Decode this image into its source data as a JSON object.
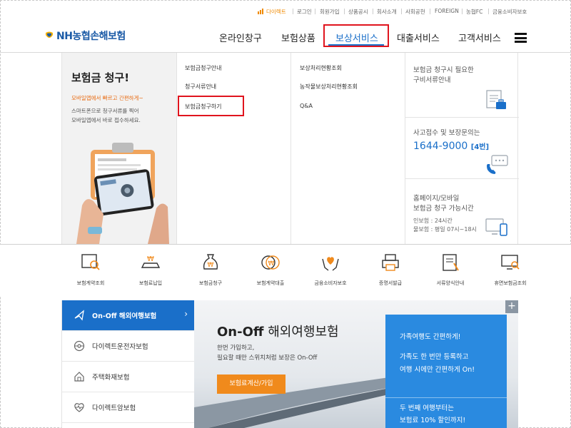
{
  "util_bar": {
    "items": [
      "다이렉트",
      "로그인",
      "회원가입",
      "상품공시",
      "회사소개",
      "사회공헌",
      "FOREIGN",
      "농협FC",
      "금융소비자보호"
    ]
  },
  "header": {
    "logo_text": "NH농협손해보험",
    "nav": [
      "온라인창구",
      "보험상품",
      "보상서비스",
      "대출서비스",
      "고객서비스"
    ],
    "active_nav": "보상서비스"
  },
  "mega_menu": {
    "promo": {
      "title": "보험금 청구!",
      "subtitle": "모바일앱에서 빠르고 간편하게~",
      "desc_line1": "스마트폰으로 청구서류를 찍어",
      "desc_line2": "모바일앱에서 바로 접수하세요."
    },
    "col1": [
      "보험금청구안내",
      "청구서류안내",
      "보험금청구하기"
    ],
    "col2": [
      "보상처리현황조회",
      "농작물보상처리현황조회",
      "Q&A"
    ],
    "info": {
      "docs_line1": "보험금 청구시 필요한",
      "docs_line2": "구비서류안내",
      "call_line1": "사고접수 및 보장문의는",
      "phone": "1644-9000",
      "phone_ext": "[4번]",
      "hours_line1": "홈페이지/모바일",
      "hours_line2": "보험금 청구 가능시간",
      "hours_line3": "인보험 : 24시간",
      "hours_line4": "물보험 : 평일 07시~18시"
    }
  },
  "quick_menu": [
    "보험계약조회",
    "보험료납입",
    "보험금청구",
    "보험계약대출",
    "금융소비자보호",
    "증명서발급",
    "서류양식안내",
    "휴면보험금조회"
  ],
  "products": [
    {
      "label": "On-Off 해외여행보험",
      "icon": "plane-icon"
    },
    {
      "label": "다이렉트운전자보험",
      "icon": "steering-wheel-icon"
    },
    {
      "label": "주택화재보험",
      "icon": "house-icon"
    },
    {
      "label": "다이렉트암보험",
      "icon": "heartbeat-icon"
    }
  ],
  "banner": {
    "title_bold": "On-Off",
    "title_rest": " 해외여행보험",
    "desc_line1": "한번 가입하고,",
    "desc_line2": "필요할 때만 스위치처럼 보장은 On-Off",
    "button": "보험료계산/가입",
    "blue_line1": "가족여행도 간편하게!",
    "blue_line2": "가족도 한 번만 등록하고",
    "blue_line3": "여행 시에만 간편하게 On!",
    "blue_line4": "두 번째 여행부터는",
    "blue_line5": "보험료 10% 할인까지!",
    "plus": "+"
  },
  "colors": {
    "brand_blue": "#1a6fc9",
    "highlight_red": "#e0141e",
    "accent_orange": "#f08a1c"
  }
}
